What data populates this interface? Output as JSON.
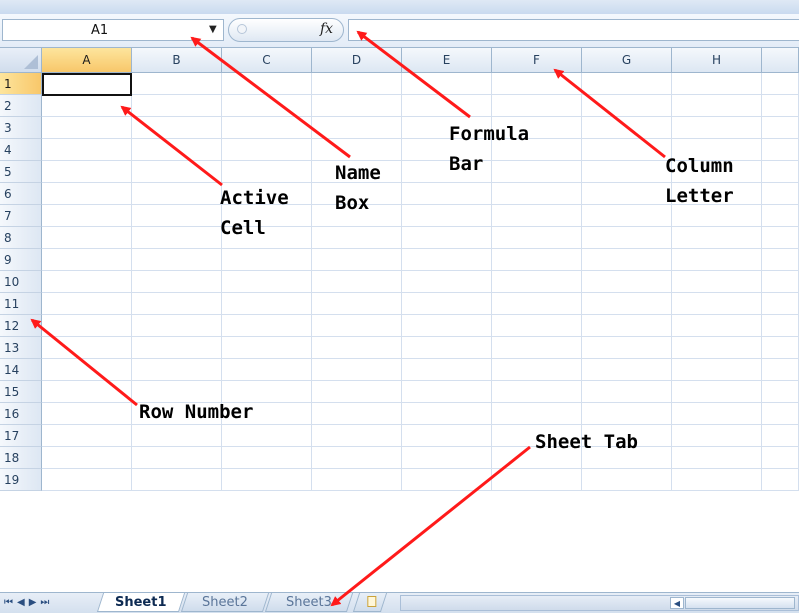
{
  "formula_bar": {
    "name_box_value": "A1",
    "fx_label": "fx",
    "formula_value": ""
  },
  "grid": {
    "columns": [
      "A",
      "B",
      "C",
      "D",
      "E",
      "F",
      "G",
      "H"
    ],
    "rows": [
      "1",
      "2",
      "3",
      "4",
      "5",
      "6",
      "7",
      "8",
      "9",
      "10",
      "11",
      "12",
      "13",
      "14",
      "15",
      "16",
      "17",
      "18",
      "19"
    ],
    "active_column": "A",
    "active_row": "1"
  },
  "sheet_tabs": {
    "tabs": [
      "Sheet1",
      "Sheet2",
      "Sheet3"
    ],
    "active": "Sheet1"
  },
  "annotations": {
    "name_box": [
      "Name",
      "Box"
    ],
    "formula_bar": [
      "Formula",
      "Bar"
    ],
    "column_letter": [
      "Column",
      "Letter"
    ],
    "active_cell": [
      "Active",
      "Cell"
    ],
    "row_number": "Row Number",
    "sheet_tab": "Sheet Tab",
    "arrow_color": "#ff1a1a"
  },
  "colors": {
    "active_header": "#f8c76a",
    "header_border": "#9eb6ce",
    "gridline": "#d4dfee"
  }
}
